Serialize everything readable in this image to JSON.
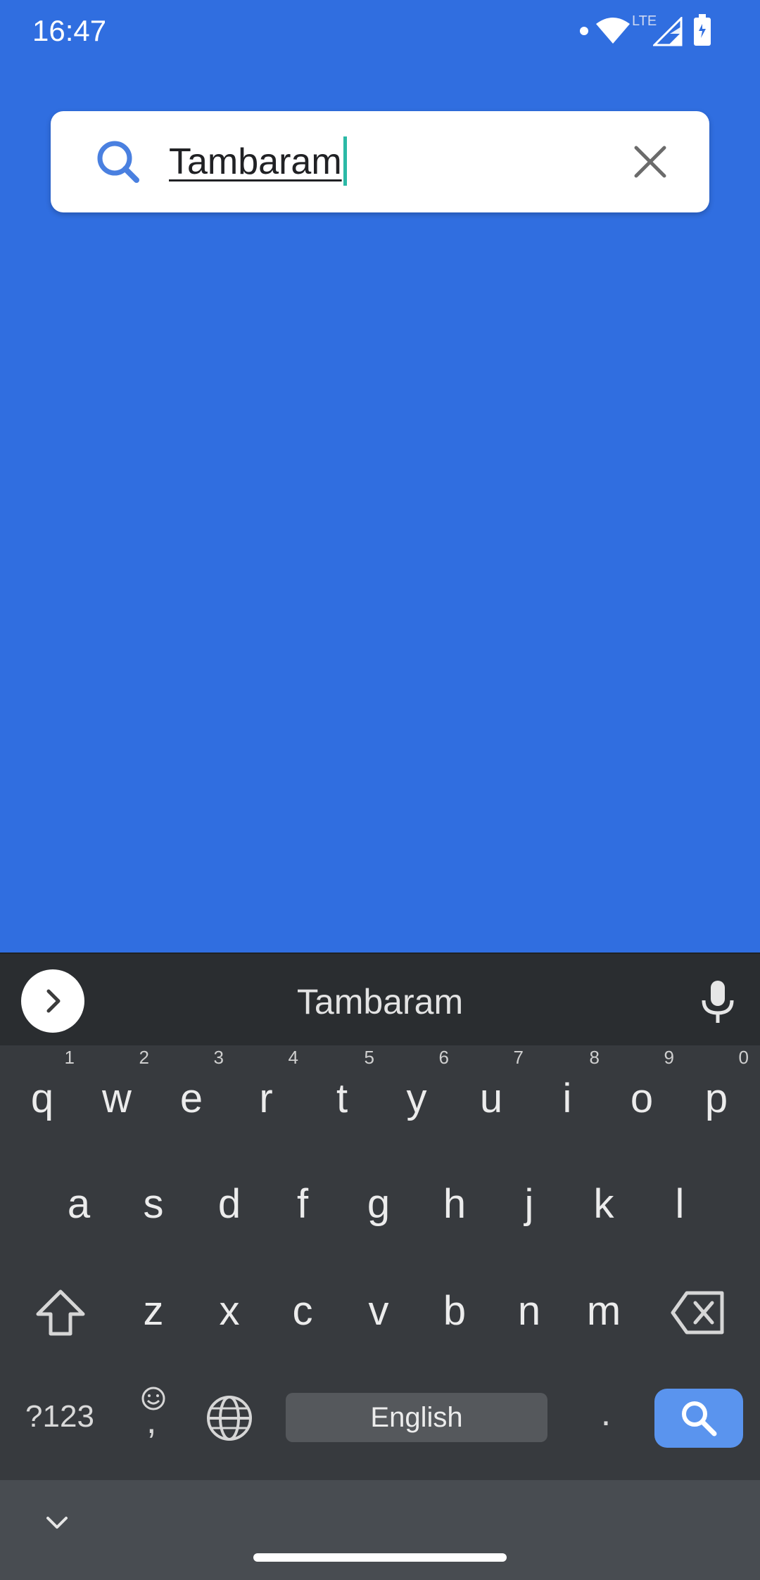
{
  "status_bar": {
    "time": "16:47",
    "network_label": "LTE",
    "icons": [
      "notification-dot-icon",
      "wifi-icon",
      "cell-signal-icon",
      "battery-icon"
    ]
  },
  "search": {
    "value": "Tambaram",
    "icons": [
      "search-icon",
      "close-icon"
    ]
  },
  "keyboard": {
    "suggestion": "Tambaram",
    "row1": [
      {
        "label": "q",
        "hint": "1"
      },
      {
        "label": "w",
        "hint": "2"
      },
      {
        "label": "e",
        "hint": "3"
      },
      {
        "label": "r",
        "hint": "4"
      },
      {
        "label": "t",
        "hint": "5"
      },
      {
        "label": "y",
        "hint": "6"
      },
      {
        "label": "u",
        "hint": "7"
      },
      {
        "label": "i",
        "hint": "8"
      },
      {
        "label": "o",
        "hint": "9"
      },
      {
        "label": "p",
        "hint": "0"
      }
    ],
    "row2": [
      "a",
      "s",
      "d",
      "f",
      "g",
      "h",
      "j",
      "k",
      "l"
    ],
    "row3": [
      "z",
      "x",
      "c",
      "v",
      "b",
      "n",
      "m"
    ],
    "symbols_label": "?123",
    "comma_label": ",",
    "space_label": "English",
    "period_label": "."
  },
  "colors": {
    "background": "#306ee0",
    "card": "#ffffff",
    "accent": "#4a80e0",
    "caret": "#2bb9a6",
    "keyboard": "#373a3e",
    "enter_key": "#5a94ee"
  }
}
